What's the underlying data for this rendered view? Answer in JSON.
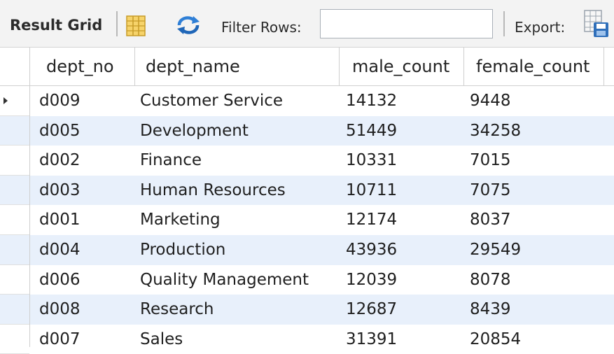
{
  "toolbar": {
    "title": "Result Grid",
    "filter_label": "Filter Rows:",
    "filter_value": "",
    "export_label": "Export:",
    "icons": [
      "grid-layout-icon",
      "refresh-icon",
      "export-icon"
    ]
  },
  "columns": [
    "dept_no",
    "dept_name",
    "male_count",
    "female_count"
  ],
  "rows": [
    [
      "d009",
      "Customer Service",
      "14132",
      "9448"
    ],
    [
      "d005",
      "Development",
      "51449",
      "34258"
    ],
    [
      "d002",
      "Finance",
      "10331",
      "7015"
    ],
    [
      "d003",
      "Human Resources",
      "10711",
      "7075"
    ],
    [
      "d001",
      "Marketing",
      "12174",
      "8037"
    ],
    [
      "d004",
      "Production",
      "43936",
      "29549"
    ],
    [
      "d006",
      "Quality Management",
      "12039",
      "8078"
    ],
    [
      "d008",
      "Research",
      "12687",
      "8439"
    ],
    [
      "d007",
      "Sales",
      "31391",
      "20854"
    ]
  ],
  "colors": {
    "row_alt": "#e8f0fb",
    "toolbar_bg": "#f3f3f3",
    "refresh_blue": "#2f7fd6"
  }
}
